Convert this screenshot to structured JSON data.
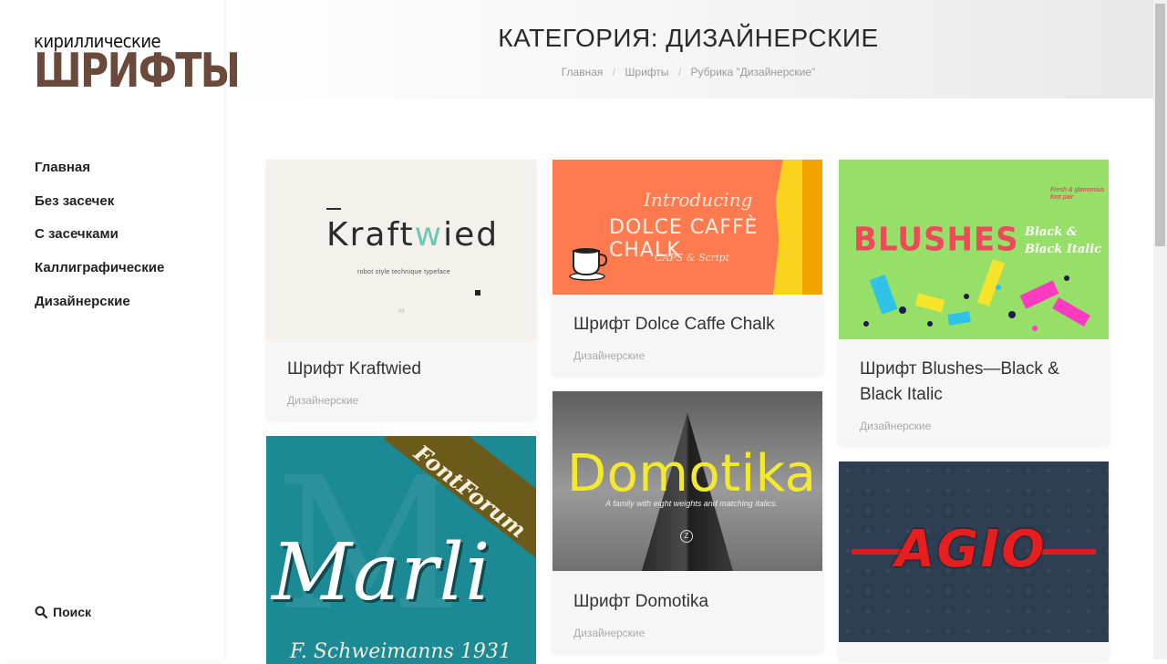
{
  "logo": {
    "line1": "кириллические",
    "line2": "ШРИФТЫ"
  },
  "nav": [
    {
      "label": "Главная"
    },
    {
      "label": "Без засечек"
    },
    {
      "label": "С засечками"
    },
    {
      "label": "Каллиграфические"
    },
    {
      "label": "Дизайнерские"
    }
  ],
  "search": {
    "label": "Поиск"
  },
  "header": {
    "title": "КАТЕГОРИЯ: ДИЗАЙНЕРСКИЕ",
    "breadcrumb": [
      "Главная",
      "Шрифты",
      "Рубрика \"Дизайнерские\""
    ],
    "separator": "/"
  },
  "cards": [
    {
      "title": "Шрифт Kraftwied",
      "category": "Дизайнерские",
      "thumb": {
        "word_a": "Kraft",
        "word_w": "w",
        "word_b": "ied",
        "subtitle": "robot style technique typeface",
        "footnote": "88"
      }
    },
    {
      "title": "Шрифт Dolce Caffe Chalk",
      "category": "Дизайнерские",
      "thumb": {
        "line1": "Introducing",
        "line2": "DOLCE CAFFÈ CHALK",
        "line3": "CAPS & Script"
      }
    },
    {
      "title": "Шрифт Blushes—Black & Black Italic",
      "category": "Дизайнерские",
      "thumb": {
        "word": "BLUSHES",
        "side_line1": "Black &",
        "side_line2": "Black Italic",
        "small_line1": "Fresh & glamorous",
        "small_line2": "font pair"
      }
    },
    {
      "title": "Шрифт Domotika",
      "category": "Дизайнерские",
      "thumb": {
        "word": "Domotika",
        "subtitle": "A family with eight weights and matching italics.",
        "badge": "Z"
      }
    },
    {
      "title": "",
      "category": "",
      "thumb": {
        "ribbon": "FontForum",
        "word": "Marli",
        "subtitle": "F. Schweimanns 1931"
      }
    },
    {
      "title": "",
      "category": "",
      "thumb": {
        "word": "AGIO"
      }
    }
  ],
  "colors": {
    "logo_brown": "#6b4a3c",
    "kraftwied_accent": "#6fc6b3",
    "dolce_bg": "#ff7a4e",
    "blushes_bg": "#96e06a",
    "blushes_word": "#f0495b",
    "marli_bg": "#1b8a94",
    "domotika_word": "#f3ea2c",
    "agio_bg": "#2d3e52",
    "agio_word": "#e51f1f"
  }
}
